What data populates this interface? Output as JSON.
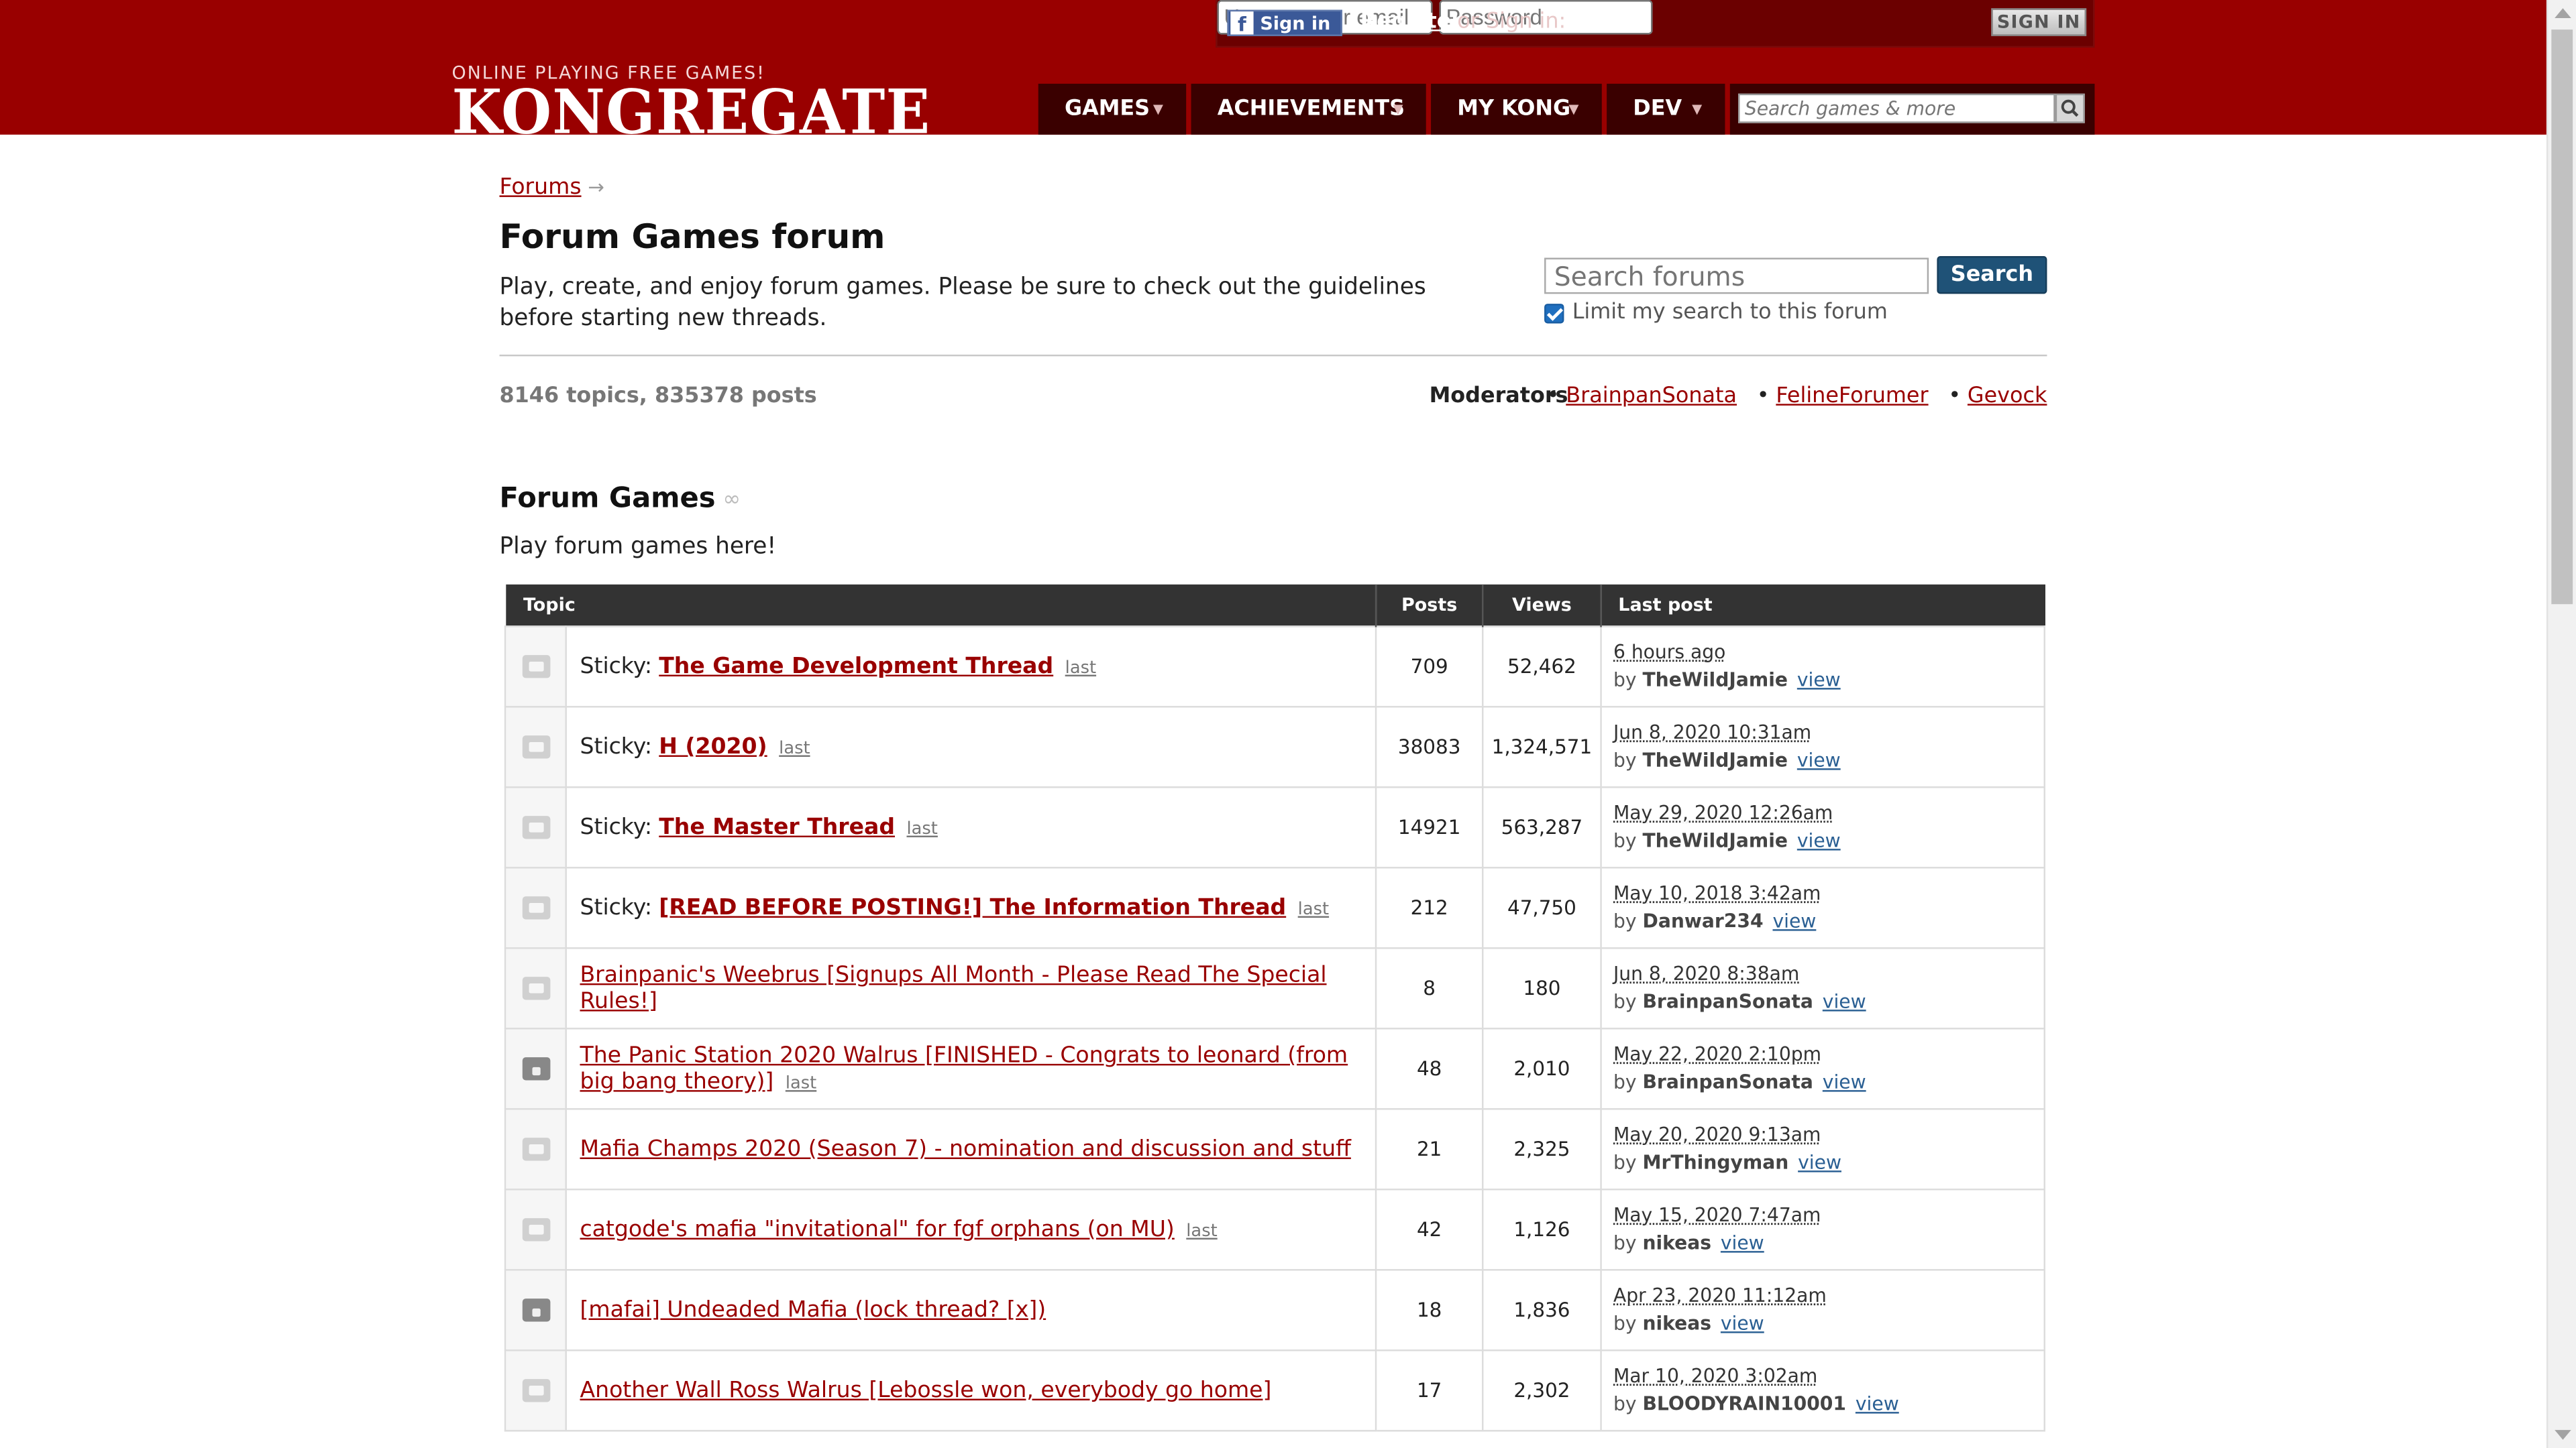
{
  "header": {
    "facebook_signin": "Sign in",
    "facebook_icon": "facebook-icon",
    "register": "Register",
    "or_sign_in": "or Sign in:",
    "username_placeholder": "Username or email",
    "password_placeholder": "Password",
    "signin_button": "SIGN IN",
    "logo_tagline": "ONLINE PLAYING FREE GAMES!",
    "logo_wordmark": "KONGREGATE",
    "nav": [
      {
        "label": "GAMES",
        "caret": "▼"
      },
      {
        "label": "ACHIEVEMENTS",
        "caret": "▼"
      },
      {
        "label": "MY KONG",
        "caret": "▼"
      },
      {
        "label": "DEV",
        "caret": "▼"
      }
    ],
    "search_placeholder": "Search games & more",
    "search_icon": "magnifier-icon"
  },
  "colors": {
    "brand_red": "#990000",
    "nav_dark": "#3a0000",
    "table_header": "#333333",
    "search_button": "#1f5277",
    "link_blue": "#2a5f93"
  },
  "breadcrumb": {
    "forums": "Forums",
    "arrow": "→"
  },
  "forum": {
    "title": "Forum Games forum",
    "description": "Play, create, and enjoy forum games. Please be sure to check out the guidelines before starting new threads.",
    "search_placeholder": "Search forums",
    "search_button": "Search",
    "limit_label": "Limit my search to this forum",
    "limit_checked": true,
    "stats": "8146 topics, 835378 posts",
    "moderators_label": "Moderators",
    "moderators": [
      "BrainpanSonata",
      "FelineForumer",
      "Gevock"
    ]
  },
  "section": {
    "title": "Forum Games",
    "link_icon": "chain-link-icon",
    "description": "Play forum games here!"
  },
  "table": {
    "headers": {
      "topic": "Topic",
      "posts": "Posts",
      "views": "Views",
      "last_post": "Last post"
    },
    "by_word": "by",
    "view_word": "view",
    "last_word": "last",
    "rows": [
      {
        "icon": "chat-bubble-icon",
        "prefix": "Sticky:",
        "title": "The Game Development Thread",
        "show_last": true,
        "posts": "709",
        "views": "52,462",
        "time": "6 hours ago",
        "author": "TheWildJamie"
      },
      {
        "icon": "chat-bubble-icon",
        "prefix": "Sticky:",
        "title": "H (2020)",
        "show_last": true,
        "posts": "38083",
        "views": "1,324,571",
        "time": "Jun 8, 2020 10:31am",
        "author": "TheWildJamie"
      },
      {
        "icon": "chat-bubble-icon",
        "prefix": "Sticky:",
        "title": "The Master Thread",
        "show_last": true,
        "posts": "14921",
        "views": "563,287",
        "time": "May 29, 2020 12:26am",
        "author": "TheWildJamie"
      },
      {
        "icon": "chat-bubble-icon",
        "prefix": "Sticky:",
        "title": "[READ BEFORE POSTING!] The Information Thread",
        "show_last": true,
        "posts": "212",
        "views": "47,750",
        "time": "May 10, 2018 3:42am",
        "author": "Danwar234"
      },
      {
        "icon": "chat-bubble-icon",
        "prefix": "",
        "title": "Brainpanic's Weebrus [Signups All Month - Please Read The Special Rules!]",
        "show_last": false,
        "posts": "8",
        "views": "180",
        "time": "Jun 8, 2020 8:38am",
        "author": "BrainpanSonata"
      },
      {
        "icon": "lock-icon",
        "prefix": "",
        "title": "The Panic Station 2020 Walrus [FINISHED - Congrats to leonard (from big bang theory)]",
        "show_last": true,
        "posts": "48",
        "views": "2,010",
        "time": "May 22, 2020 2:10pm",
        "author": "BrainpanSonata"
      },
      {
        "icon": "chat-bubble-icon",
        "prefix": "",
        "title": "Mafia Champs 2020 (Season 7) - nomination and discussion and stuff",
        "show_last": false,
        "posts": "21",
        "views": "2,325",
        "time": "May 20, 2020 9:13am",
        "author": "MrThingyman"
      },
      {
        "icon": "chat-bubble-icon",
        "prefix": "",
        "title": "catgode's mafia \"invitational\" for fgf orphans (on MU)",
        "show_last": true,
        "posts": "42",
        "views": "1,126",
        "time": "May 15, 2020 7:47am",
        "author": "nikeas"
      },
      {
        "icon": "lock-icon",
        "prefix": "",
        "title": "[mafai] Undeaded Mafia (lock thread? [x])",
        "show_last": false,
        "posts": "18",
        "views": "1,836",
        "time": "Apr 23, 2020 11:12am",
        "author": "nikeas"
      },
      {
        "icon": "chat-bubble-icon",
        "prefix": "",
        "title": "Another Wall Ross Walrus [Lebossle won, everybody go home]",
        "show_last": false,
        "posts": "17",
        "views": "2,302",
        "time": "Mar 10, 2020 3:02am",
        "author": "BLOODYRAIN10001"
      }
    ]
  }
}
